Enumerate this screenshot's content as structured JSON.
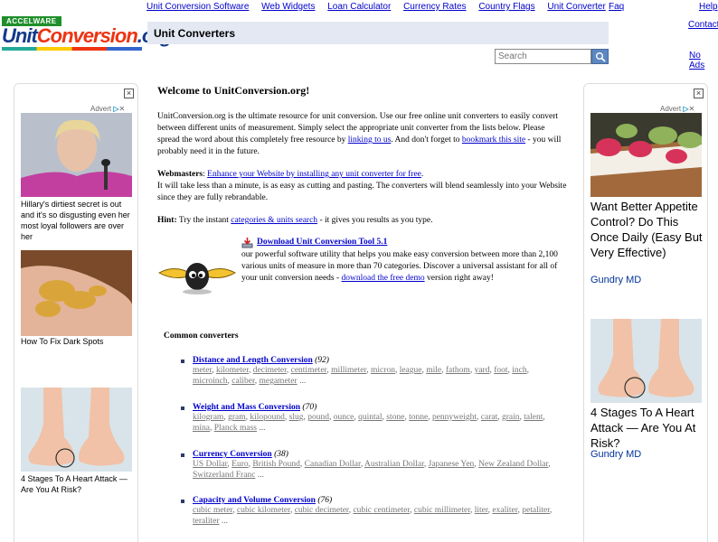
{
  "logo": {
    "tag": "ACCELWARE",
    "word_a": "Unit",
    "word_b": "Conversion",
    "word_c": ".org"
  },
  "topnav": [
    "Unit Conversion Software",
    "Web Widgets",
    "Loan Calculator",
    "Currency Rates",
    "Country Flags",
    "Unit Converter"
  ],
  "side_links": {
    "faq": "Faq",
    "help": "Help",
    "contact": "Contact",
    "no_ads": "No Ads"
  },
  "title": "Unit Converters",
  "search": {
    "placeholder": "Search"
  },
  "ads": {
    "choices": "Advert",
    "left": [
      {
        "caption": "Hillary's dirtiest secret is out and it's so disgusting even her most loyal followers are over her"
      },
      {
        "caption": "How To Fix Dark Spots"
      },
      {
        "caption": "4 Stages To A Heart Attack — Are You At Risk?"
      }
    ],
    "right": [
      {
        "caption": "Want Better Appetite Control? Do This Once Daily (Easy But Very Effective)",
        "source": "Gundry MD"
      },
      {
        "caption": "4 Stages To A Heart Attack — Are You At Risk?",
        "source": "Gundry MD"
      }
    ]
  },
  "main": {
    "welcome": "Welcome to UnitConversion.org!",
    "intro_a": "UnitConversion.org is the ultimate resource for unit conversion. Use our free online unit converters to easily convert between different units of measurement. Simply select the appropriate unit converter from the lists below. Please spread the word about this completely free resource by ",
    "intro_link1": "linking to us",
    "intro_b": ". And don't forget to ",
    "intro_link2": "bookmark this site",
    "intro_c": " - you will probably need it in the future.",
    "webmasters_label": "Webmasters",
    "webmasters_link": "Enhance your Website by installing any unit converter for free",
    "webmasters_text": "It will take less than a minute, is as easy as cutting and pasting. The converters will blend seamlessly into your Website since they are fully rebrandable.",
    "hint_label": "Hint:",
    "hint_a": " Try the instant ",
    "hint_link": "categories & units search",
    "hint_b": " - it gives you results as you type.",
    "tool_link": "Download Unit Conversion Tool 5.1",
    "tool_text": "our powerful software utility that helps you make easy conversion between more than 2,100 various units of measure in more than 70 categories. Discover a universal assistant for all of your unit conversion needs - ",
    "tool_demo": "download the free demo",
    "tool_end": " version right away!",
    "common_heading": "Common converters"
  },
  "categories": [
    {
      "name": "Distance and Length Conversion",
      "count": "(92)",
      "units": [
        "meter",
        "kilometer",
        "decimeter",
        "centimeter",
        "millimeter",
        "micron",
        "league",
        "mile",
        "fathom",
        "yard",
        "foot",
        "inch",
        "microinch",
        "caliber",
        "megameter"
      ]
    },
    {
      "name": "Weight and Mass Conversion",
      "count": "(70)",
      "units": [
        "kilogram",
        "gram",
        "kilopound",
        "slug",
        "pound",
        "ounce",
        "quintal",
        "stone",
        "tonne",
        "pennyweight",
        "carat",
        "grain",
        "talent",
        "mina",
        "Planck mass"
      ]
    },
    {
      "name": "Currency Conversion",
      "count": "(38)",
      "units": [
        "US Dollar",
        "Euro",
        "British Pound",
        "Canadian Dollar",
        "Australian Dollar",
        "Japanese Yen",
        "New Zealand Dollar",
        "Switzerland Franc"
      ]
    },
    {
      "name": "Capacity and Volume Conversion",
      "count": "(76)",
      "units": [
        "cubic meter",
        "cubic kilometer",
        "cubic decimeter",
        "cubic centimeter",
        "cubic millimeter",
        "liter",
        "exaliter",
        "petaliter",
        "teraliter"
      ]
    }
  ],
  "colors": {
    "link": "#0000cc",
    "title_bar": "#e3e8f2",
    "search_button": "#5d87c1",
    "logo_green": "#1f8f2b"
  }
}
